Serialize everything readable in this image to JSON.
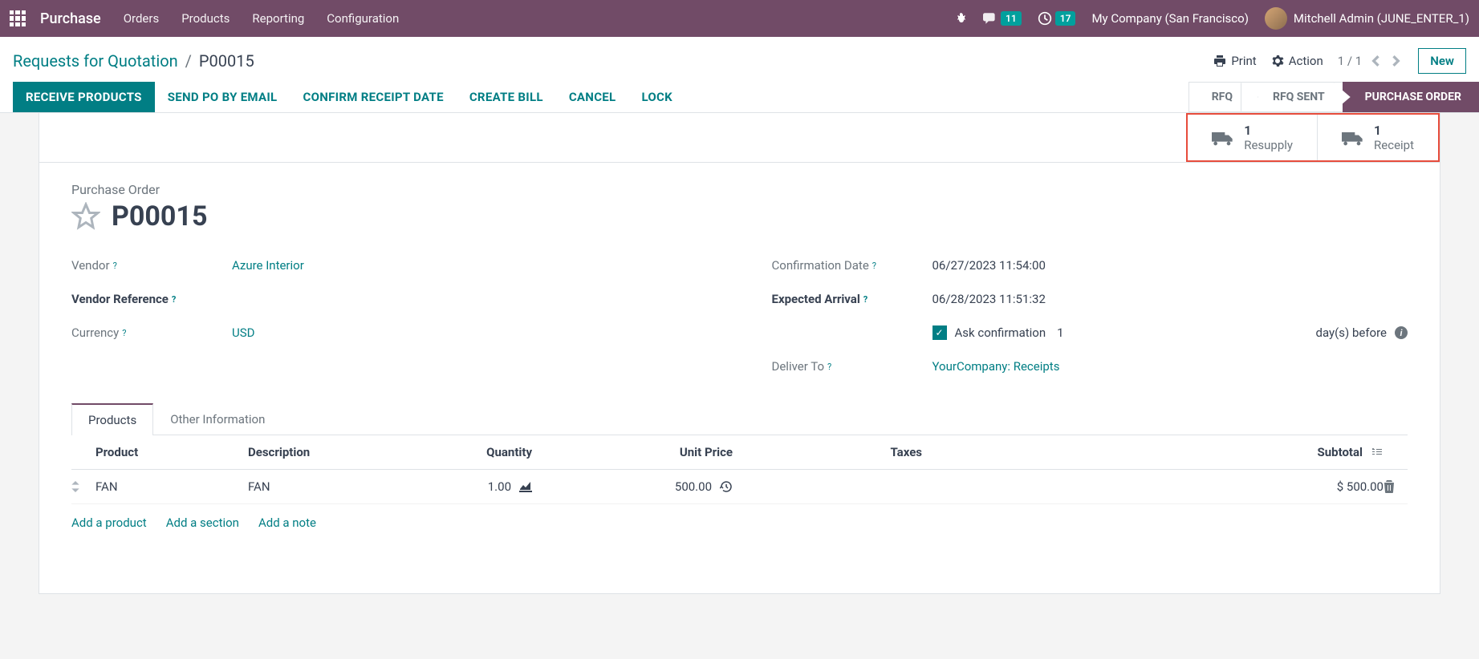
{
  "nav": {
    "brand": "Purchase",
    "items": [
      "Orders",
      "Products",
      "Reporting",
      "Configuration"
    ],
    "messages_count": "11",
    "activities_count": "17",
    "company": "My Company (San Francisco)",
    "user": "Mitchell Admin (JUNE_ENTER_1)"
  },
  "breadcrumb": {
    "parent": "Requests for Quotation",
    "current": "P00015"
  },
  "cp_actions": {
    "print": "Print",
    "action": "Action",
    "pager": "1 / 1",
    "new": "New"
  },
  "buttons": {
    "receive": "RECEIVE PRODUCTS",
    "send_po": "SEND PO BY EMAIL",
    "confirm_date": "CONFIRM RECEIPT DATE",
    "create_bill": "CREATE BILL",
    "cancel": "CANCEL",
    "lock": "LOCK"
  },
  "status": [
    "RFQ",
    "RFQ SENT",
    "PURCHASE ORDER"
  ],
  "stat_buttons": [
    {
      "count": "1",
      "label": "Resupply"
    },
    {
      "count": "1",
      "label": "Receipt"
    }
  ],
  "form": {
    "title_label": "Purchase Order",
    "name": "P00015",
    "labels": {
      "vendor": "Vendor",
      "vendor_ref": "Vendor Reference",
      "currency": "Currency",
      "confirm_date": "Confirmation Date",
      "expected": "Expected Arrival",
      "deliver_to": "Deliver To",
      "ask_confirm": "Ask confirmation",
      "days_before": "day(s) before"
    },
    "values": {
      "vendor": "Azure Interior",
      "currency": "USD",
      "confirm_date": "06/27/2023 11:54:00",
      "expected": "06/28/2023 11:51:32",
      "ask_days": "1",
      "deliver_to": "YourCompany: Receipts"
    }
  },
  "tabs": [
    "Products",
    "Other Information"
  ],
  "table": {
    "headers": {
      "product": "Product",
      "description": "Description",
      "quantity": "Quantity",
      "unit_price": "Unit Price",
      "taxes": "Taxes",
      "subtotal": "Subtotal"
    },
    "rows": [
      {
        "product": "FAN",
        "description": "FAN",
        "qty": "1.00",
        "price": "500.00",
        "subtotal": "$ 500.00"
      }
    ],
    "add": {
      "product": "Add a product",
      "section": "Add a section",
      "note": "Add a note"
    }
  }
}
